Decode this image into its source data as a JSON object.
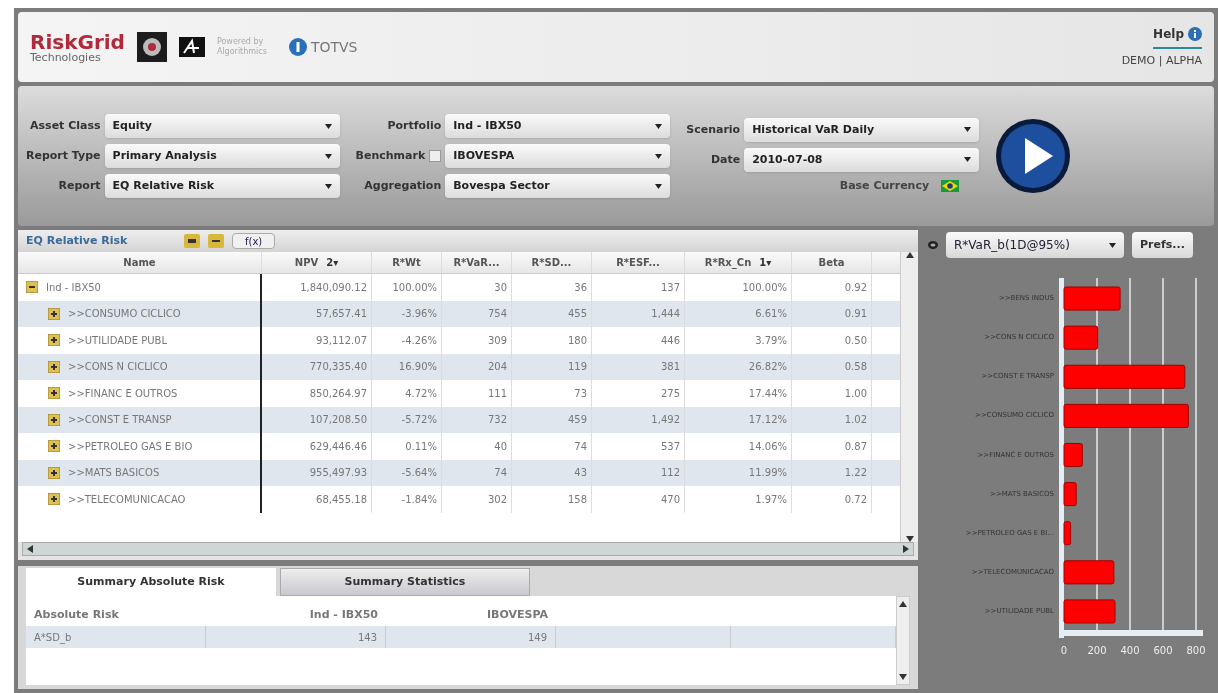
{
  "header": {
    "brand": "RiskGrid",
    "brand_sub": "Technologies",
    "powered": "Powered by Algorithmics",
    "partner": "TOTVS",
    "help": "Help",
    "env": "DEMO | ALPHA"
  },
  "filters": [
    {
      "label": "Asset Class",
      "value": "Equity"
    },
    {
      "label": "Report Type",
      "value": "Primary Analysis"
    },
    {
      "label": "Report",
      "value": "EQ Relative Risk"
    },
    {
      "label": "Portfolio",
      "value": "Ind - IBX50"
    },
    {
      "label": "Benchmark",
      "value": "IBOVESPA",
      "checked": false
    },
    {
      "label": "Aggregation",
      "value": "Bovespa Sector"
    },
    {
      "label": "Scenario",
      "value": "Historical VaR Daily"
    },
    {
      "label": "Date",
      "value": "2010-07-08"
    }
  ],
  "base_currency": "Base Currency",
  "report_panel": {
    "title": "EQ Relative Risk",
    "fx_button": "f(x)",
    "columns": [
      {
        "label": "Name"
      },
      {
        "label": "NPV",
        "sort": "2▾"
      },
      {
        "label": "R*Wt"
      },
      {
        "label": "R*VaR..."
      },
      {
        "label": "R*SD..."
      },
      {
        "label": "R*ESF..."
      },
      {
        "label": "R*Rx_Cn",
        "sort": "1▾"
      },
      {
        "label": "Beta"
      }
    ],
    "rows": [
      {
        "cells": [
          "Ind - IBX50",
          "1,840,090.12",
          "100.00%",
          "30",
          "36",
          "137",
          "100.00%",
          "0.92"
        ],
        "expanded": true,
        "children": [
          {
            "cells": [
              ">>CONSUMO CICLICO",
              "57,657.41",
              "-3.96%",
              "754",
              "455",
              "1,444",
              "6.61%",
              "0.91"
            ],
            "expanded": false
          },
          {
            "cells": [
              ">>UTILIDADE PUBL",
              "93,112.07",
              "-4.26%",
              "309",
              "180",
              "446",
              "3.79%",
              "0.50"
            ],
            "expanded": false
          },
          {
            "cells": [
              ">>CONS N CICLICO",
              "770,335.40",
              "16.90%",
              "204",
              "119",
              "381",
              "26.82%",
              "0.58"
            ],
            "expanded": false
          },
          {
            "cells": [
              ">>FINANC E OUTROS",
              "850,264.97",
              "4.72%",
              "111",
              "73",
              "275",
              "17.44%",
              "1.00"
            ],
            "expanded": false
          },
          {
            "cells": [
              ">>CONST E TRANSP",
              "107,208.50",
              "-5.72%",
              "732",
              "459",
              "1,492",
              "17.12%",
              "1.02"
            ],
            "expanded": false
          },
          {
            "cells": [
              ">>PETROLEO GAS E BIO",
              "629,446.46",
              "0.11%",
              "40",
              "74",
              "537",
              "14.06%",
              "0.87"
            ],
            "expanded": false
          },
          {
            "cells": [
              ">>MATS BASICOS",
              "955,497.93",
              "-5.64%",
              "74",
              "43",
              "112",
              "11.99%",
              "1.22"
            ],
            "expanded": false
          },
          {
            "cells": [
              ">>TELECOMUNICACAO",
              "68,455.18",
              "-1.84%",
              "302",
              "158",
              "470",
              "1.97%",
              "0.72"
            ],
            "expanded": false
          }
        ]
      }
    ]
  },
  "chart_panel": {
    "measure": "R*VaR_b(1D@95%)",
    "prefs_button": "Prefs...",
    "chart_data": {
      "type": "bar",
      "orientation": "horizontal",
      "categories": [
        ">>BENS INDUS",
        ">>CONS N CICLICO",
        ">>CONST E TRANSP",
        ">>CONSUMO CICLICO",
        ">>FINANC E OUTROS",
        ">>MATS BASICOS",
        ">>PETROLEO GAS E BI...",
        ">>TELECOMUNICACAO",
        ">>UTILIDADE PUBL"
      ],
      "series": [
        {
          "color": "#ff0000",
          "values": [
            340,
            204,
            732,
            754,
            111,
            74,
            40,
            302,
            309
          ]
        }
      ],
      "xlim": [
        0,
        800
      ],
      "xticks": [
        0,
        200,
        400,
        600,
        800
      ],
      "grid": true
    }
  },
  "summary": {
    "tabs": [
      {
        "label": "Summary Absolute Risk",
        "selected": true
      },
      {
        "label": "Summary Statistics",
        "selected": false
      }
    ],
    "columns": [
      "Absolute Risk",
      "Ind - IBX50",
      "IBOVESPA"
    ],
    "rows": [
      [
        "A*SD_b",
        "143",
        "149"
      ]
    ]
  }
}
